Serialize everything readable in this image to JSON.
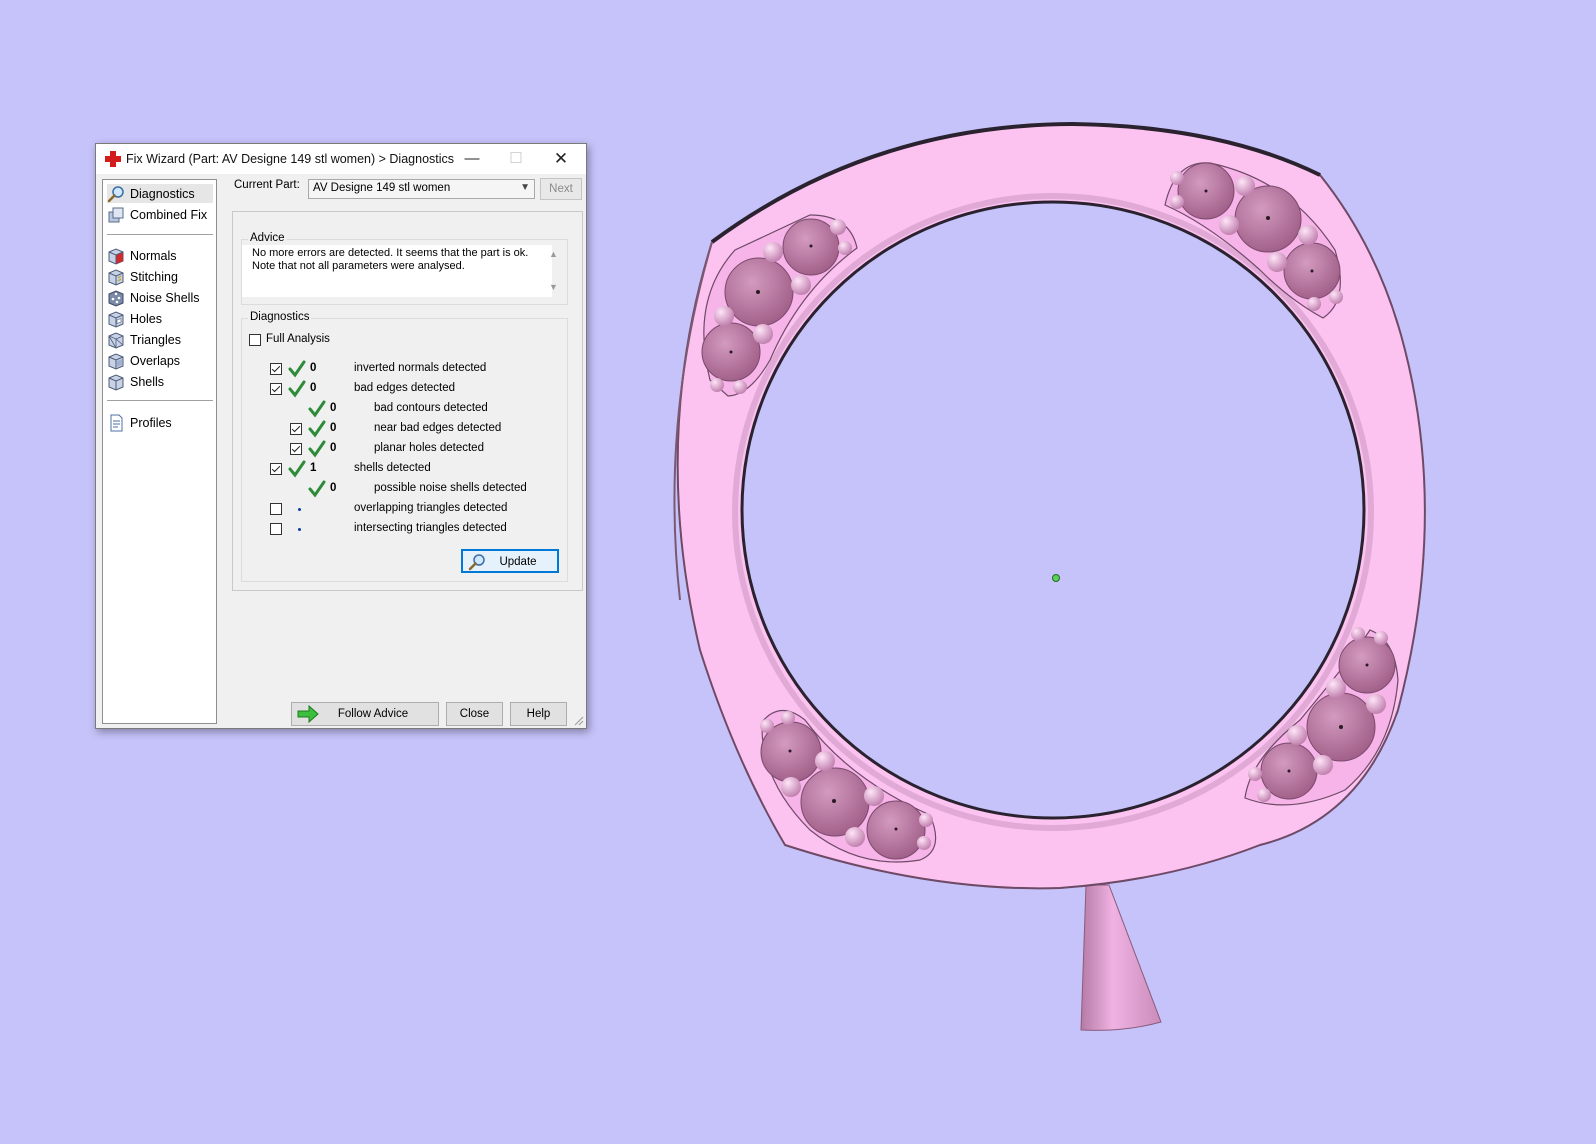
{
  "window": {
    "title": "Fix Wizard (Part: AV Designe 149 stl women) > Diagnostics",
    "minimize_symbol": "—",
    "maximize_symbol": "☐",
    "close_symbol": "✕"
  },
  "nav": {
    "items": [
      {
        "label": "Diagnostics",
        "icon": "magnifier-icon",
        "selected": true
      },
      {
        "label": "Combined Fix",
        "icon": "combined-fix-icon"
      },
      {
        "label": "Normals",
        "icon": "normals-cube-icon"
      },
      {
        "label": "Stitching",
        "icon": "stitching-cube-icon"
      },
      {
        "label": "Noise Shells",
        "icon": "noise-shells-cube-icon"
      },
      {
        "label": "Holes",
        "icon": "holes-cube-icon"
      },
      {
        "label": "Triangles",
        "icon": "triangles-cube-icon"
      },
      {
        "label": "Overlaps",
        "icon": "overlaps-cube-icon"
      },
      {
        "label": "Shells",
        "icon": "shells-cube-icon"
      },
      {
        "label": "Profiles",
        "icon": "profile-document-icon"
      }
    ]
  },
  "current_part": {
    "label": "Current Part:",
    "value": "AV Designe 149 stl women",
    "next_label": "Next"
  },
  "advice": {
    "group_title": "Advice",
    "text_line1": "No more errors are detected. It seems that the part is ok.",
    "text_line2": "Note that not all parameters were analysed."
  },
  "diagnostics": {
    "group_title": "Diagnostics",
    "full_analysis_label": "Full Analysis",
    "full_analysis_checked": false,
    "rows": [
      {
        "checked": true,
        "status": "ok",
        "count": "0",
        "label": "inverted normals detected"
      },
      {
        "checked": true,
        "status": "ok",
        "count": "0",
        "label": "bad edges detected"
      },
      {
        "checkbox": false,
        "status": "ok",
        "count": "0",
        "label": "bad contours detected"
      },
      {
        "checked": true,
        "status": "ok",
        "count": "0",
        "label": "near bad edges detected"
      },
      {
        "checked": true,
        "status": "ok",
        "count": "0",
        "label": "planar holes detected"
      },
      {
        "checked": true,
        "status": "ok",
        "count": "1",
        "label": "shells detected"
      },
      {
        "checkbox": false,
        "status": "ok",
        "count": "0",
        "label": "possible noise shells detected"
      },
      {
        "checked": false,
        "status": "not-analysed",
        "count": "",
        "label": "overlapping triangles detected"
      },
      {
        "checked": false,
        "status": "not-analysed",
        "count": "",
        "label": "intersecting triangles detected"
      }
    ],
    "update_label": "Update"
  },
  "footer": {
    "follow_advice_label": "Follow Advice",
    "close_label": "Close",
    "help_label": "Help"
  },
  "colors": {
    "viewport_background": "#c6c3fa",
    "model_pink": "#fdc3f2",
    "gem_mauve": "#c27fa8",
    "ok_green": "#2e8b3a",
    "focus_blue": "#0078d7"
  }
}
